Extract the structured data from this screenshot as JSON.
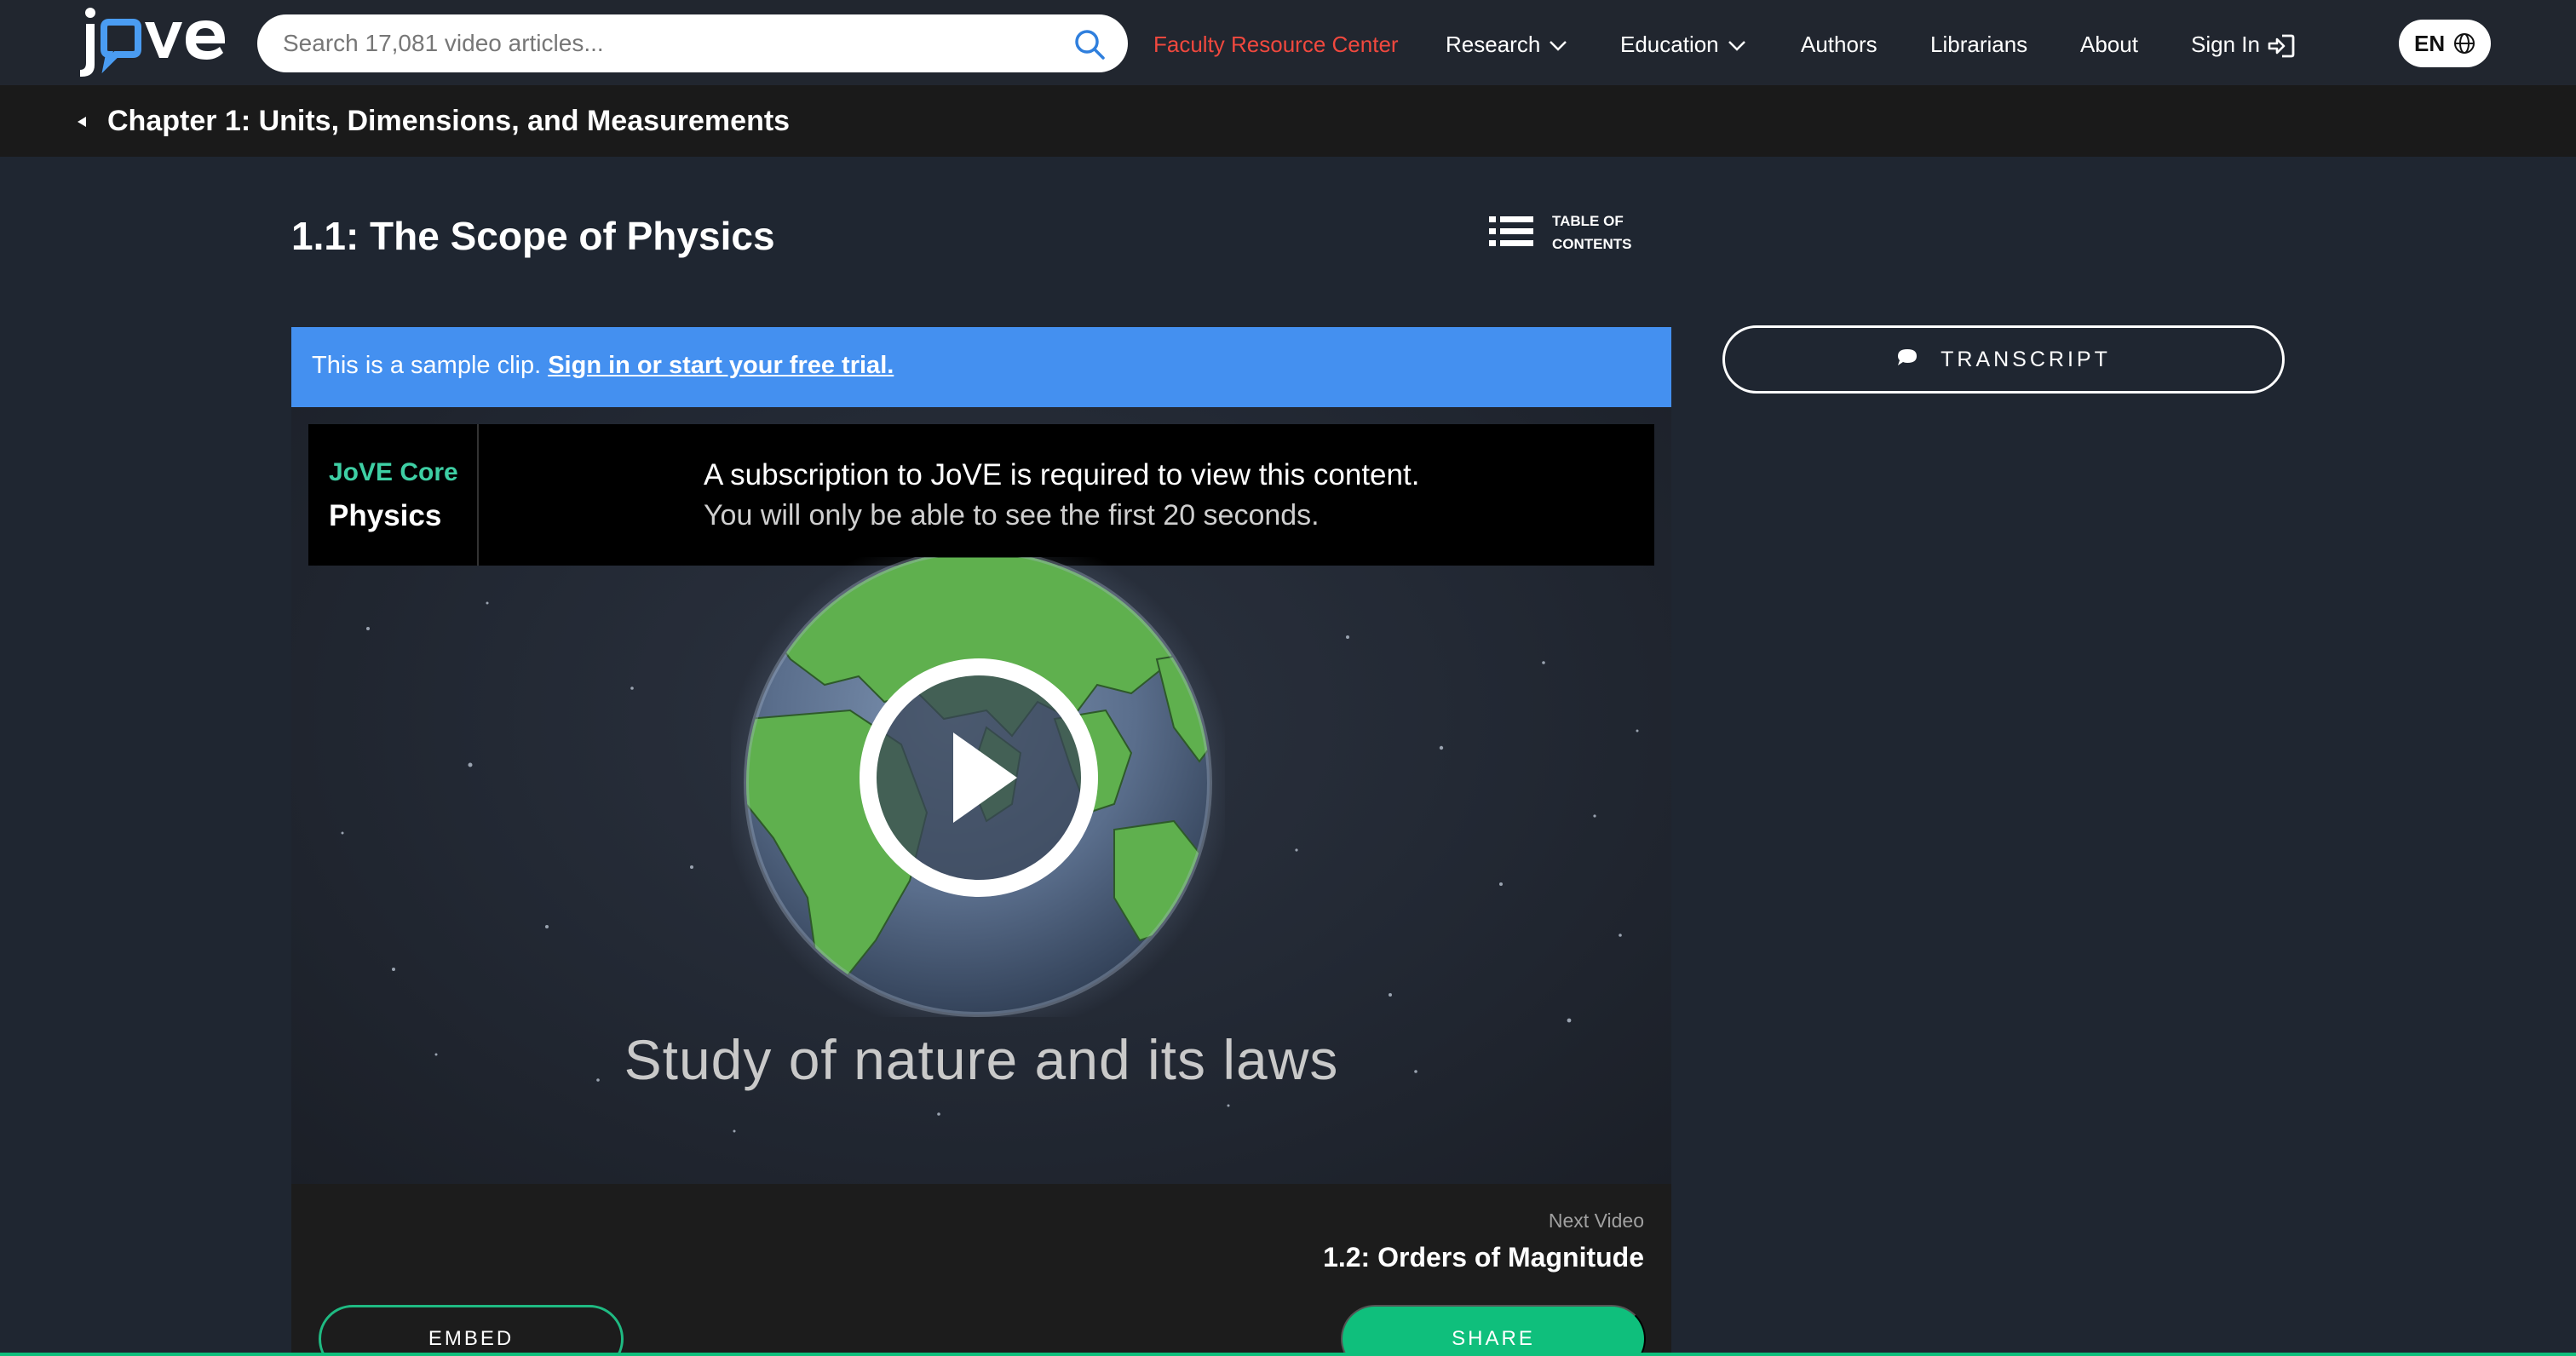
{
  "nav": {
    "search_placeholder": "Search 17,081 video articles...",
    "faculty": "Faculty Resource Center",
    "research": "Research",
    "education": "Education",
    "authors": "Authors",
    "librarians": "Librarians",
    "about": "About",
    "sign_in": "Sign In",
    "language": "EN"
  },
  "chapter": {
    "title": "Chapter 1: Units, Dimensions, and Measurements"
  },
  "page": {
    "title": "1.1: The Scope of Physics",
    "toc_line1": "TABLE OF",
    "toc_line2": "CONTENTS"
  },
  "banner": {
    "text": "This is a sample clip.",
    "link": "Sign in or start your free trial."
  },
  "video": {
    "brand_top": "JoVE Core",
    "brand_bottom": "Physics",
    "notice_line1": "A subscription to JoVE is required to view this content.",
    "notice_line2": "You will only be able to see the first 20 seconds.",
    "caption": "Study of nature and its laws"
  },
  "footer": {
    "next_label": "Next Video",
    "next_title": "1.2: Orders of Magnitude",
    "embed": "EMBED",
    "share": "SHARE"
  },
  "transcript": {
    "label": "TRANSCRIPT"
  },
  "colors": {
    "accent_red": "#f0483e",
    "banner_blue": "#4490f0",
    "brand_green": "#0fbf7c",
    "brand_teal": "#3ecfa4"
  }
}
